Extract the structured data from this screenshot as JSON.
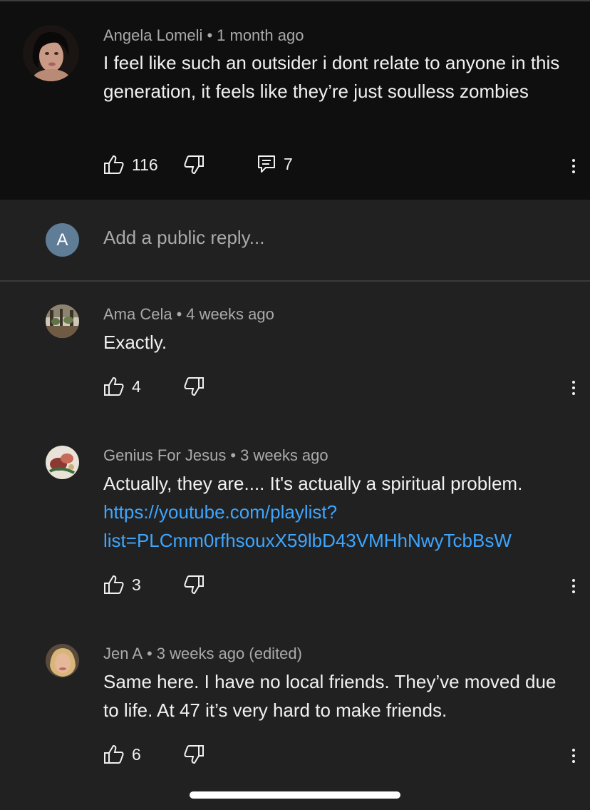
{
  "parent_comment": {
    "author": "Angela Lomeli",
    "time": "1 month ago",
    "text": "I feel like such an outsider i dont relate to anyone in this generation, it feels like they’re just soulless zombies",
    "likes": "116",
    "replies": "7"
  },
  "reply_box": {
    "avatar_letter": "A",
    "placeholder": "Add a public reply..."
  },
  "replies": [
    {
      "author": "Ama Cela",
      "time": "4 weeks ago",
      "text": "Exactly.",
      "likes": "4"
    },
    {
      "author": "Genius For Jesus",
      "time": "3 weeks ago",
      "text": "Actually, they are.... It's actually a spiritual problem.",
      "link": "https://youtube.com/playlist?list=PLCmm0rfhsouxX59lbD43VMHhNwyTcbBsW",
      "link_line1": "https://youtube.com/playlist?",
      "link_line2": "list=PLCmm0rfhsouxX59lbD43VMHhNwyTcbBsW",
      "likes": "3"
    },
    {
      "author": "Jen A",
      "time": "3 weeks ago (edited)",
      "text": "Same here. I have no local friends. They’ve moved due to life. At 47 it’s very hard to make friends.",
      "likes": "6"
    }
  ],
  "icons": {
    "like": "thumb-up-icon",
    "dislike": "thumb-down-icon",
    "reply": "comment-icon",
    "more": "more-vert-icon"
  },
  "colors": {
    "background": "#212121",
    "parent_background": "#0f0f0f",
    "link": "#3ea6ff",
    "secondary_text": "#aaaaaa"
  }
}
